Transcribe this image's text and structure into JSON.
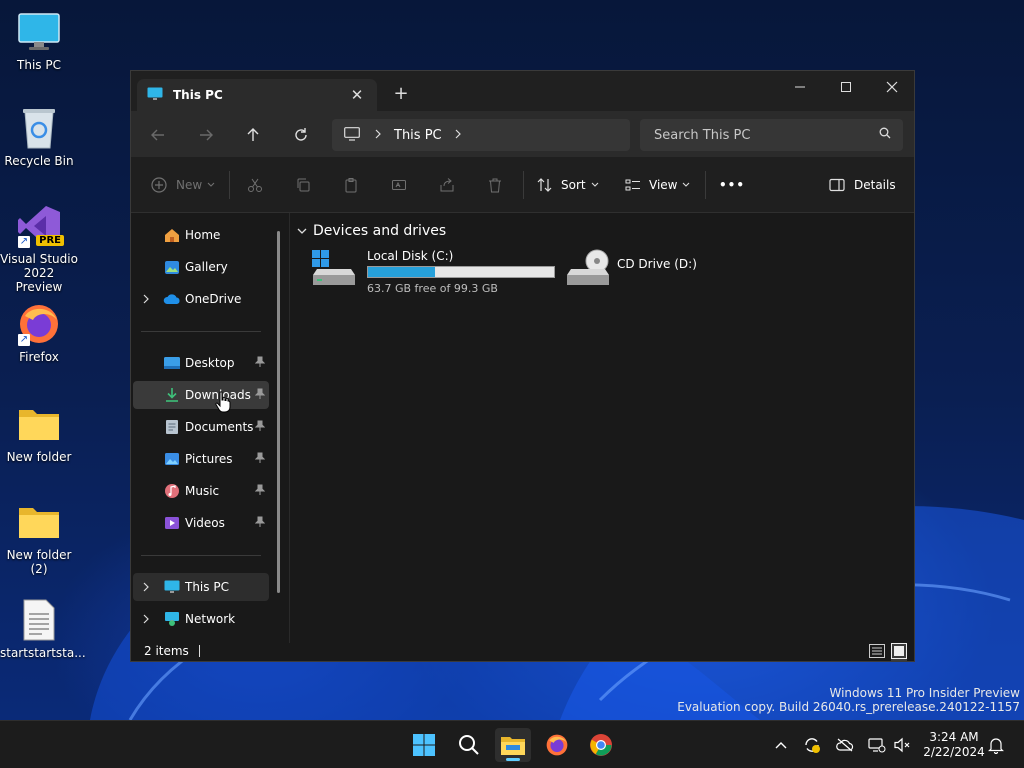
{
  "desktop": {
    "icons": [
      {
        "label": "This PC",
        "icon": "monitor-icon"
      },
      {
        "label": "Recycle Bin",
        "icon": "recycle-bin-icon"
      },
      {
        "label": "Visual Studio 2022 Preview",
        "icon": "visual-studio-icon",
        "badge": "PRE"
      },
      {
        "label": "Firefox",
        "icon": "firefox-icon"
      },
      {
        "label": "New folder",
        "icon": "folder-icon"
      },
      {
        "label": "New folder (2)",
        "icon": "folder-icon"
      },
      {
        "label": "startstartsta...",
        "icon": "text-document-icon"
      }
    ]
  },
  "window": {
    "tab_title": "This PC",
    "new_tab_label": "+",
    "address": {
      "crumbs": [
        "This PC"
      ]
    },
    "search": {
      "placeholder": "Search This PC"
    },
    "commands": {
      "new": "New",
      "sort": "Sort",
      "view": "View",
      "more": "•••",
      "details": "Details"
    },
    "nav": {
      "top": [
        {
          "label": "Home",
          "icon": "home-icon"
        },
        {
          "label": "Gallery",
          "icon": "gallery-icon"
        },
        {
          "label": "OneDrive",
          "icon": "onedrive-icon"
        }
      ],
      "quick_access": [
        {
          "label": "Desktop",
          "icon": "desktop-icon"
        },
        {
          "label": "Downloads",
          "icon": "downloads-icon"
        },
        {
          "label": "Documents",
          "icon": "documents-icon"
        },
        {
          "label": "Pictures",
          "icon": "pictures-icon"
        },
        {
          "label": "Music",
          "icon": "music-icon"
        },
        {
          "label": "Videos",
          "icon": "videos-icon"
        }
      ],
      "bottom": [
        {
          "label": "This PC",
          "icon": "this-pc-icon"
        },
        {
          "label": "Network",
          "icon": "network-icon"
        }
      ]
    },
    "content": {
      "group_title": "Devices and drives",
      "drives": [
        {
          "name": "Local Disk (C:)",
          "free_text": "63.7 GB free of 99.3 GB",
          "used_fraction": 0.359
        },
        {
          "name": "CD Drive (D:)"
        }
      ]
    },
    "status": {
      "items": "2 items"
    }
  },
  "watermark": {
    "line1": "Windows 11 Pro Insider Preview",
    "line2": "Evaluation copy. Build 26040.rs_prerelease.240122-1157"
  },
  "taskbar": {
    "time": "3:24 AM",
    "date": "2/22/2024"
  },
  "colors": {
    "accent": "#60cdff",
    "usage_fill": "#26a0da",
    "window_bg": "#191919"
  }
}
